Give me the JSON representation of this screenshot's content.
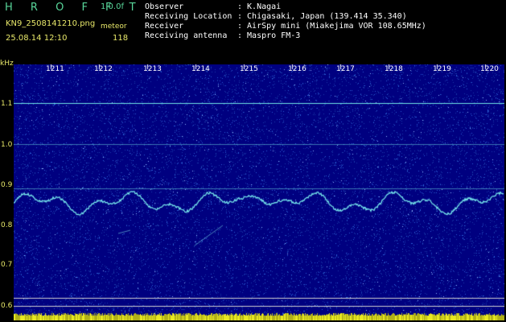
{
  "header": {
    "app_title": "H R O F F T",
    "version": "1.0.0f",
    "file_name": "KN9_2508141210.png",
    "mode": "meteor",
    "timestamp": "25.08.14 12:10",
    "count": "118"
  },
  "info": [
    {
      "label": "Observer",
      "value": ": K.Nagai"
    },
    {
      "label": "Receiving Location",
      "value": ": Chigasaki, Japan (139.414 35.340)"
    },
    {
      "label": "Receiver",
      "value": ": AirSpy mini (Miakejima VOR 108.65MHz)"
    },
    {
      "label": "Receiving antenna",
      "value": ": Maspro FM-3"
    }
  ],
  "plot": {
    "y_unit": "kHz",
    "y_labels": [
      "1.1",
      "1.0",
      "0.9",
      "0.8",
      "0.7",
      "0.6"
    ],
    "x_labels": [
      "1211",
      "1212",
      "1213",
      "1214",
      "1215",
      "1216",
      "1217",
      "1218",
      "1219",
      "1220"
    ],
    "colors": {
      "background": "#000080",
      "noise": "#2a5fd6",
      "trace": "#7af0f0",
      "axis_text": "#e8e86a",
      "bottom_bar": "#e8e820"
    }
  }
}
